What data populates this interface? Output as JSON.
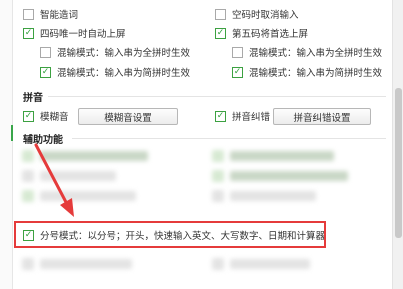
{
  "options": {
    "smart_adjust": "智能造词",
    "empty_code_cancel": "空码时取消输入",
    "four_code_auto": "四码唯一时自动上屏",
    "fifth_code_select": "第五码将首选上屏",
    "mixed_full": "混输模式：输入串为全拼时生效",
    "mixed_jianpin": "混输模式：输入串为简拼时生效"
  },
  "pinyin": {
    "section_title": "拼音",
    "fuzzy_label": "模糊音",
    "fuzzy_settings_button": "模糊音设置",
    "correction_label": "拼音纠错",
    "correction_settings_button": "拼音纠错设置"
  },
  "aux": {
    "section_title": "辅助功能",
    "semicolon_mode": "分号模式：以分号；开头，快速输入英文、大写数字、日期和计算器"
  },
  "colors": {
    "check_green": "#2e9e3a",
    "highlight_red": "#e53b3b"
  }
}
